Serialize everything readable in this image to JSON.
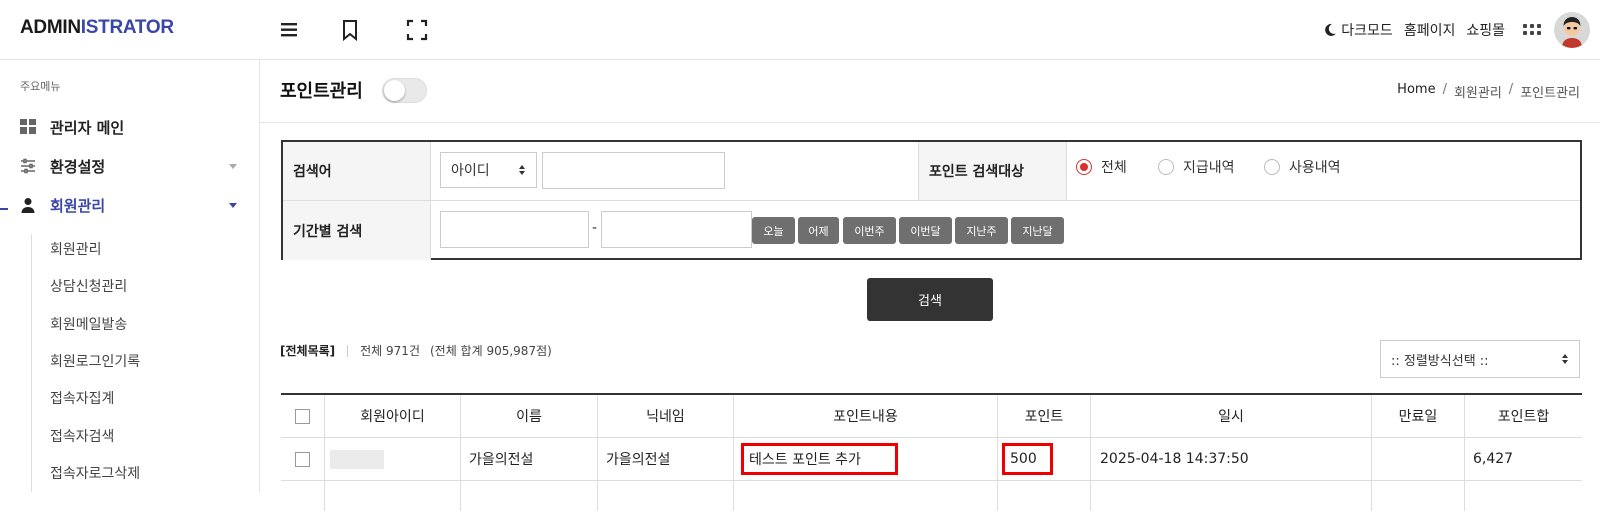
{
  "header": {
    "logo_part1": "ADMIN",
    "logo_part2": "ISTRATOR",
    "links": {
      "darkmode": "다크모드",
      "homepage": "홈페이지",
      "shop": "쇼핑몰"
    }
  },
  "sidebar": {
    "heading": "주요메뉴",
    "items": [
      {
        "label": "관리자 메인",
        "icon": "dashboard-icon"
      },
      {
        "label": "환경설정",
        "icon": "sliders-icon"
      },
      {
        "label": "회원관리",
        "icon": "user-icon"
      }
    ],
    "sub_items": [
      "회원관리",
      "상담신청관리",
      "회원메일발송",
      "회원로그인기록",
      "접속자집계",
      "접속자검색",
      "접속자로그삭제"
    ]
  },
  "page": {
    "title": "포인트관리",
    "breadcrumb": [
      "Home",
      "회원관리",
      "포인트관리"
    ]
  },
  "search": {
    "keyword_label": "검색어",
    "keyword_field": "아이디",
    "keyword_value": "",
    "target_label": "포인트 검색대상",
    "target_options": [
      "전체",
      "지급내역",
      "사용내역"
    ],
    "target_selected": "전체",
    "period_label": "기간별 검색",
    "period_from": "",
    "period_to": "",
    "period_sep": "-",
    "quick_buttons": [
      "오늘",
      "어제",
      "이번주",
      "이번달",
      "지난주",
      "지난달"
    ],
    "submit_label": "검색"
  },
  "summary": {
    "list_label": "[전체목록]",
    "total_text": "전체 971건",
    "sum_text": "(전체 합계 905,987점)"
  },
  "sort": {
    "placeholder": ":: 정렬방식선택 ::"
  },
  "table": {
    "columns": [
      "",
      "회원아이디",
      "이름",
      "닉네임",
      "포인트내용",
      "포인트",
      "일시",
      "만료일",
      "포인트합"
    ],
    "rows": [
      {
        "member_id": "",
        "name": "가을의전설",
        "nickname": "가을의전설",
        "content": "테스트 포인트 추가",
        "point": "500",
        "datetime": "2025-04-18 14:37:50",
        "expire": "",
        "total": "6,427"
      }
    ]
  },
  "colors": {
    "accent": "#3a47a8",
    "highlight": "#e00000",
    "radio_on": "#d93030"
  }
}
